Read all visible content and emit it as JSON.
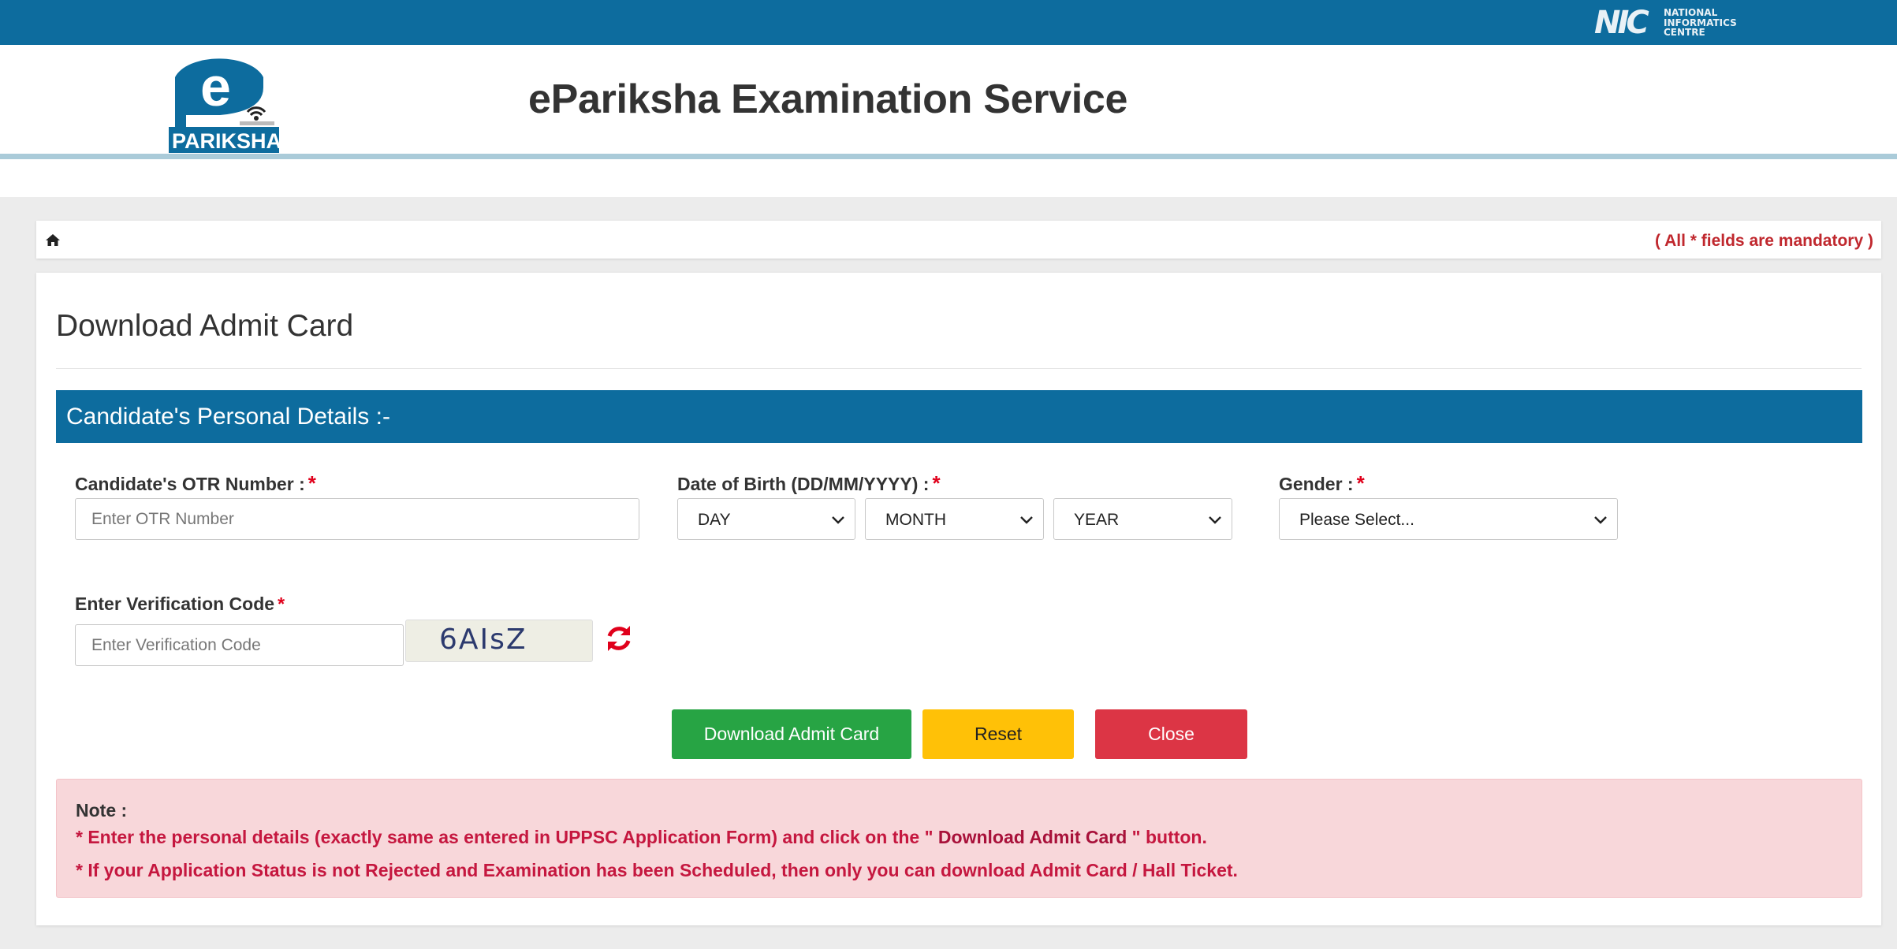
{
  "topbar": {
    "nic_letters": "NIC",
    "nic_text": "NATIONAL\nINFORMATICS\nCENTRE"
  },
  "header": {
    "logo_letter": "e",
    "logo_word": "PARIKSHA",
    "site_title": "ePariksha Examination Service"
  },
  "breadcrumb": {
    "home_icon": "home-icon",
    "mandatory_note": "( All * fields are mandatory )"
  },
  "page": {
    "title": "Download Admit Card",
    "section_title": "Candidate's Personal Details :-"
  },
  "form": {
    "otr": {
      "label": "Candidate's OTR Number :",
      "required_mark": "*",
      "placeholder": "Enter OTR Number"
    },
    "dob": {
      "label": "Date of Birth (DD/MM/YYYY) :",
      "required_mark": "*",
      "day": "DAY",
      "month": "MONTH",
      "year": "YEAR"
    },
    "gender": {
      "label": "Gender :",
      "required_mark": "*",
      "selected": "Please Select..."
    },
    "verification": {
      "label": "Enter Verification Code",
      "required_mark": "*",
      "placeholder": "Enter Verification Code",
      "captcha_text": "6AIsZ"
    }
  },
  "buttons": {
    "download": "Download Admit Card",
    "reset": "Reset",
    "close": "Close"
  },
  "note": {
    "label": "Note :",
    "line1_prefix": "* Enter the personal details (exactly same as entered in UPPSC Application Form) and click on the \"",
    "line1_bold": " Download Admit Card ",
    "line1_suffix": "\" button.",
    "line2": "* If your Application Status is not Rejected and Examination has been Scheduled, then only you can download Admit Card / Hall Ticket."
  },
  "colors": {
    "primary_blue": "#0d6c9e",
    "header_line": "#aacbd9",
    "required_red": "#e0001b",
    "button_green": "#27a444",
    "button_yellow": "#ffc107",
    "button_red": "#dc3545",
    "note_bg": "#f8d7da",
    "note_text": "#c5173f"
  }
}
